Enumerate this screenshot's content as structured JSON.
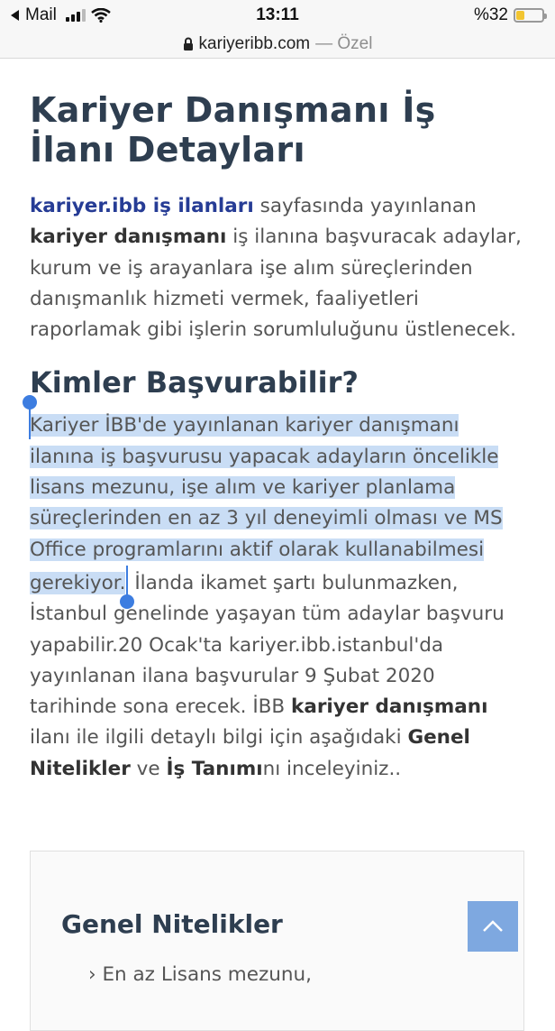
{
  "status_bar": {
    "carrier": "Mail",
    "time": "13:11",
    "battery_percent": "%32",
    "battery_level": 0.32
  },
  "url_bar": {
    "domain": "kariyeribb.com",
    "private_label": "— Özel"
  },
  "article": {
    "title": "Kariyer Danışmanı İş İlanı Detayları",
    "intro": {
      "link": "kariyer.ibb iş ilanları",
      "t1": " sayfasında yayınlanan ",
      "b1": "kariyer danışmanı",
      "t2": " iş ilanına başvuracak adaylar, kurum ve iş arayanlara işe alım süreçlerinden danışmanlık hizmeti vermek, faaliyetleri raporlamak gibi işlerin sorumluluğunu üstlenecek."
    },
    "section_heading": "Kimler Başvurabilir?",
    "section": {
      "selected": "Kariyer İBB'de yayınlanan kariyer danışmanı ilanına iş başvurusu yapacak adayların öncelikle lisans mezunu, işe alım ve kariyer planlama süreçlerinden en az 3 yıl deneyimli olması ve MS Office programlarını aktif olarak kullanabilmesi gerekiyor.",
      "t1": " İlanda ikamet şartı bulunmazken, İstanbul genelinde yaşayan tüm adaylar başvuru yapabilir.20 Ocak'ta kariyer.ibb.istanbul'da yayınlanan ilana başvurular 9 Şubat 2020 tarihinde sona erecek. İBB ",
      "b1": "kariyer danışmanı",
      "t2": " ilanı ile ilgili detaylı bilgi için aşağıdaki ",
      "b2": "Genel Nitelikler",
      "t3": " ve ",
      "b3": "İş Tanımı",
      "t4": "nı inceleyiniz.."
    }
  },
  "card": {
    "title": "Genel Nitelikler",
    "first_item": "Lisans mezunu,",
    "first_item_prefix": "En az"
  },
  "icons": {
    "back_arrow": "back-arrow-icon",
    "wifi": "wifi-icon",
    "lock": "lock-icon",
    "battery": "battery-icon",
    "scroll_top": "chevron-up-icon"
  },
  "colors": {
    "heading": "#2e3e50",
    "link": "#263c95",
    "selection": "#c9ddf5",
    "selection_handle": "#3d7de0",
    "scroll_top_button": "#7ea8e0"
  }
}
